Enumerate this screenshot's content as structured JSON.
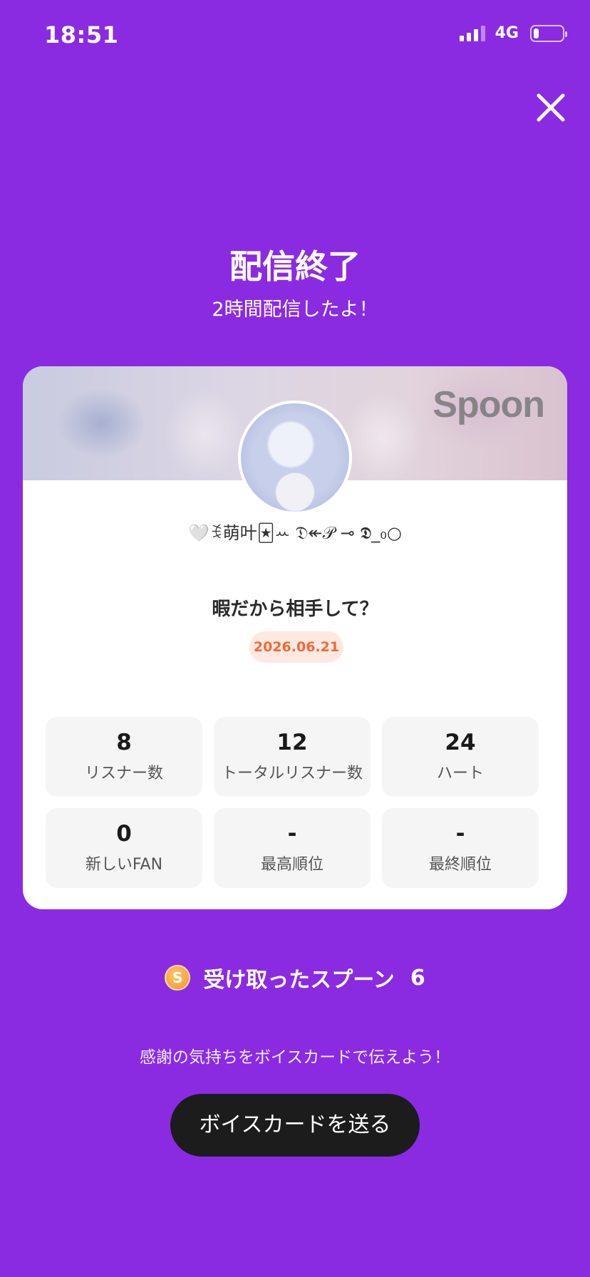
{
  "status_bar": {
    "time": "18:51",
    "network": "4G",
    "battery_level": 0.18
  },
  "header": {
    "close_icon": "close-icon",
    "title": "配信終了",
    "subtitle": "2時間配信したよ！"
  },
  "card": {
    "logo_text": "Spoon",
    "nickname": "🤍ꉂ萌叶🃏ꕀ 𝔇↞𝒫 ⊸ 𝕯_₀○",
    "broadcast_title": "暇だから相手して？",
    "date": "2026.06.21",
    "stats": [
      {
        "value": "8",
        "label": "リスナー数"
      },
      {
        "value": "12",
        "label": "トータルリスナー数"
      },
      {
        "value": "24",
        "label": "ハート"
      },
      {
        "value": "0",
        "label": "新しいFAN"
      },
      {
        "value": "-",
        "label": "最高順位"
      },
      {
        "value": "-",
        "label": "最終順位"
      }
    ]
  },
  "spoons": {
    "coin_symbol": "S",
    "label": "受け取ったスプーン",
    "count": "6"
  },
  "footer": {
    "thanks_text": "感謝の気持ちをボイスカードで伝えよう！",
    "button_label": "ボイスカードを送る"
  },
  "colors": {
    "background": "#8A2BE2",
    "button": "#1C1C1C",
    "date_badge_text": "#F06A3A",
    "date_badge_bg": "#FDE9E2"
  }
}
